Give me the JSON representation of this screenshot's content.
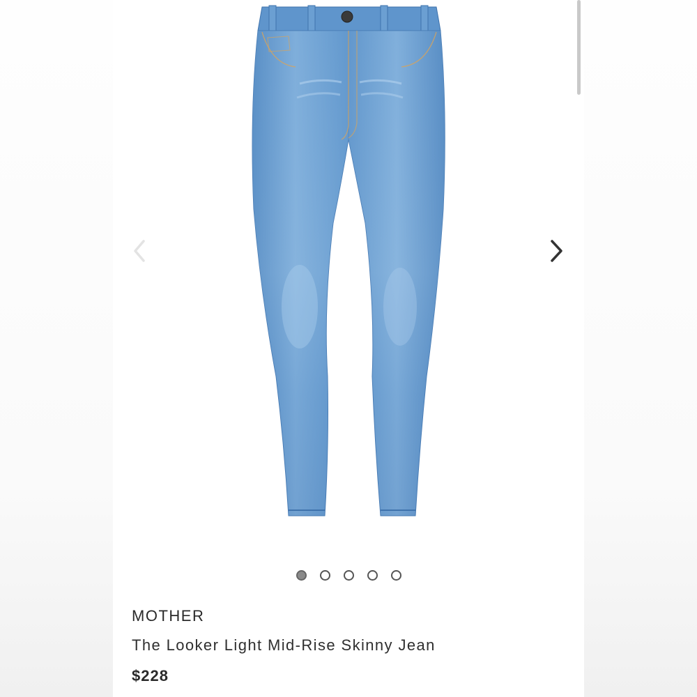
{
  "carousel": {
    "prev_icon": "chevron-left-icon",
    "next_icon": "chevron-right-icon",
    "image": "denim-jeans-product-photo",
    "dots": [
      {
        "active": true
      },
      {
        "active": false
      },
      {
        "active": false
      },
      {
        "active": false
      },
      {
        "active": false
      }
    ]
  },
  "product": {
    "brand": "MOTHER",
    "name": "The Looker Light Mid-Rise Skinny Jean",
    "price": "$228"
  },
  "colors": {
    "denim_light": "#8db8e0",
    "denim_mid": "#5f95cc",
    "denim_dark": "#3f73ad",
    "dot_active": "#8a8a8a",
    "text": "#2a2a2a"
  }
}
